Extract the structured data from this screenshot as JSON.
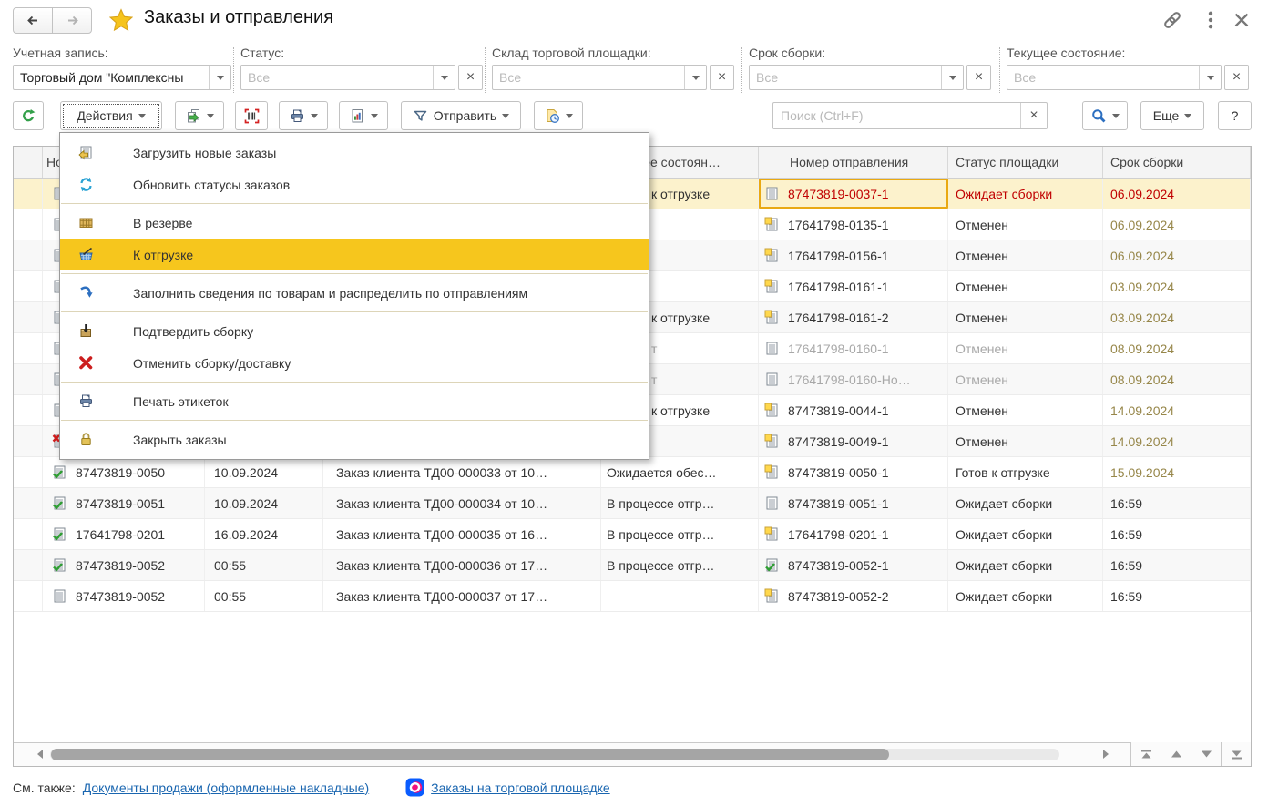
{
  "window": {
    "title": "Заказы и отправления"
  },
  "filters": [
    {
      "label": "Учетная запись:",
      "value": "Торговый дом \"Комплексны",
      "placeholder": "",
      "has_clear": false
    },
    {
      "label": "Статус:",
      "value": "",
      "placeholder": "Все",
      "has_clear": true
    },
    {
      "label": "Склад торговой площадки:",
      "value": "",
      "placeholder": "Все",
      "has_clear": true
    },
    {
      "label": "Срок сборки:",
      "value": "",
      "placeholder": "Все",
      "has_clear": true
    },
    {
      "label": "Текущее состояние:",
      "value": "",
      "placeholder": "Все",
      "has_clear": true
    }
  ],
  "toolbar": {
    "actions_label": "Действия",
    "send_label": "Отправить",
    "more_label": "Еще",
    "help_label": "?",
    "search_placeholder": "Поиск (Ctrl+F)"
  },
  "menu": {
    "items": [
      {
        "icon": "load-doc",
        "label": "Загрузить новые заказы"
      },
      {
        "icon": "refresh-blue",
        "label": "Обновить статусы заказов"
      },
      {
        "sep": true
      },
      {
        "icon": "crate",
        "label": "В резерве"
      },
      {
        "icon": "basket",
        "label": "К отгрузке",
        "highlight": true
      },
      {
        "sep": true
      },
      {
        "icon": "curve-arrow",
        "label": "Заполнить сведения по товарам и распределить по отправлениям"
      },
      {
        "sep": true
      },
      {
        "icon": "box-down",
        "label": "Подтвердить сборку"
      },
      {
        "icon": "red-x",
        "label": "Отменить сборку/доставку"
      },
      {
        "sep": true
      },
      {
        "icon": "printer",
        "label": "Печать этикеток"
      },
      {
        "sep": true
      },
      {
        "icon": "lock",
        "label": "Закрыть заказы"
      }
    ]
  },
  "table": {
    "headers": {
      "number": "Номер",
      "state": "Текущее состоян…",
      "ship_number": "Номер отправления",
      "status": "Статус площадки",
      "term": "Срок сборки"
    },
    "rows": [
      {
        "sel": true,
        "focus": true,
        "icon": "doc",
        "number": "",
        "date": "",
        "doc": "",
        "state": "к отгрузке",
        "state_indent": true,
        "ship_icon": "doc",
        "ship": "87473819-0037-1",
        "ship_color": "red",
        "status": "Ожидает сборки",
        "status_color": "red",
        "term": "06.09.2024",
        "term_color": "red"
      },
      {
        "icon": "doc",
        "state": "",
        "ship_icon": "doc-note",
        "ship": "17641798-0135-1",
        "status": "Отменен",
        "term": "06.09.2024",
        "term_color": "olive"
      },
      {
        "icon": "doc",
        "state": "",
        "ship_icon": "doc-note",
        "ship": "17641798-0156-1",
        "status": "Отменен",
        "term": "06.09.2024",
        "term_color": "olive"
      },
      {
        "icon": "doc",
        "state": "",
        "ship_icon": "doc-note",
        "ship": "17641798-0161-1",
        "status": "Отменен",
        "term": "03.09.2024",
        "term_color": "olive"
      },
      {
        "icon": "doc",
        "state": "к отгрузке",
        "state_indent": true,
        "ship_icon": "doc-note",
        "ship": "17641798-0161-2",
        "status": "Отменен",
        "term": "03.09.2024",
        "term_color": "olive"
      },
      {
        "icon": "doc",
        "muted": true,
        "state": "т",
        "state_indent": true,
        "ship_icon": "doc",
        "ship": "17641798-0160-1",
        "ship_color": "muted",
        "status": "Отменен",
        "status_color": "muted",
        "term": "08.09.2024",
        "term_color": "olive"
      },
      {
        "icon": "doc",
        "muted": true,
        "state": "т",
        "state_indent": true,
        "ship_icon": "doc",
        "ship": "17641798-0160-Но…",
        "ship_color": "muted",
        "status": "Отменен",
        "status_color": "muted",
        "term": "08.09.2024",
        "term_color": "olive"
      },
      {
        "icon": "doc",
        "state": "к отгрузке",
        "state_indent": true,
        "ship_icon": "doc-note",
        "ship": "87473819-0044-1",
        "status": "Отменен",
        "term": "14.09.2024",
        "term_color": "olive"
      },
      {
        "icon": "doc-x",
        "state": "",
        "ship_icon": "doc-note",
        "ship": "87473819-0049-1",
        "status": "Отменен",
        "term": "14.09.2024",
        "term_color": "olive"
      },
      {
        "icon": "doc-check",
        "number": "87473819-0050",
        "date": "10.09.2024",
        "doc": "Заказ клиента ТД00-000033 от 10…",
        "state": "Ожидается обес…",
        "ship_icon": "doc-note",
        "ship": "87473819-0050-1",
        "status": "Готов к отгрузке",
        "term": "15.09.2024",
        "term_color": "olive"
      },
      {
        "icon": "doc-check",
        "number": "87473819-0051",
        "date": "10.09.2024",
        "doc": "Заказ клиента ТД00-000034 от 10…",
        "state": "В процессе отгр…",
        "ship_icon": "doc",
        "ship": "87473819-0051-1",
        "status": "Ожидает сборки",
        "term": "16:59"
      },
      {
        "icon": "doc-check",
        "number": "17641798-0201",
        "date": "16.09.2024",
        "doc": "Заказ клиента ТД00-000035 от 16…",
        "state": "В процессе отгр…",
        "ship_icon": "doc-note",
        "ship": "17641798-0201-1",
        "status": "Ожидает сборки",
        "term": "16:59"
      },
      {
        "icon": "doc-check",
        "number": "87473819-0052",
        "date": "00:55",
        "doc": "Заказ клиента ТД00-000036 от 17…",
        "state": "В процессе отгр…",
        "ship_icon": "doc-check",
        "ship": "87473819-0052-1",
        "status": "Ожидает сборки",
        "term": "16:59"
      },
      {
        "icon": "doc",
        "number": "87473819-0052",
        "date": "00:55",
        "doc": "Заказ клиента ТД00-000037 от 17…",
        "state": "",
        "ship_icon": "doc-note",
        "ship": "87473819-0052-2",
        "status": "Ожидает сборки",
        "term": "16:59"
      }
    ]
  },
  "footer": {
    "see_also": "См. также:",
    "link1": "Документы продажи (оформленные накладные)",
    "link2": "Заказы на торговой площадке"
  },
  "colors": {
    "accent_yellow": "#f6c61d",
    "selected_row": "#fcf2cc",
    "focus_cell_border": "#e9a912",
    "alert_red": "#c00000",
    "due_olive": "#97874a",
    "link_blue": "#1a66b0"
  }
}
